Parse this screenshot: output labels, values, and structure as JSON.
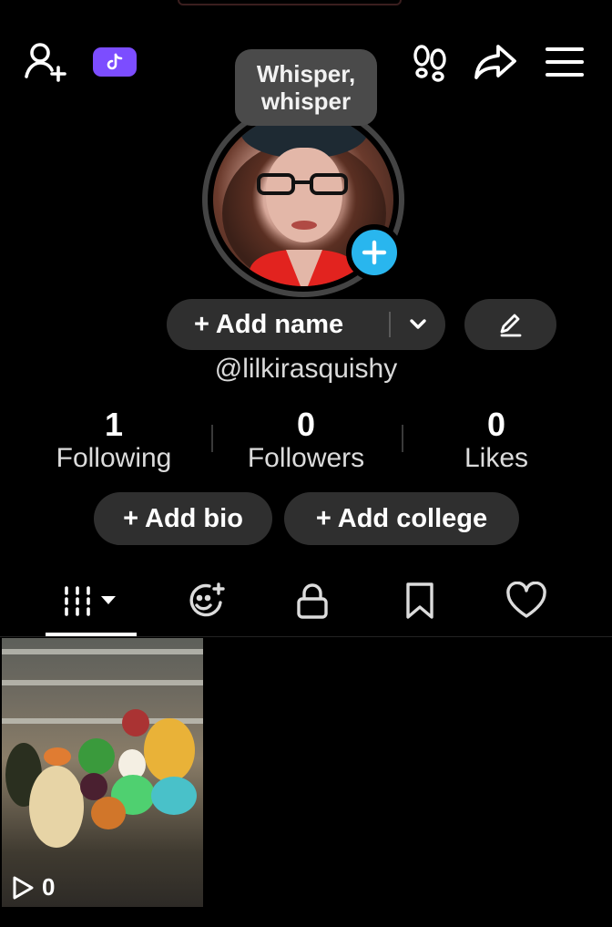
{
  "profile": {
    "tooltip_line1": "Whisper,",
    "tooltip_line2": "whisper",
    "add_name_label": "+ Add name",
    "username": "@lilkirasquishy"
  },
  "stats": [
    {
      "value": "1",
      "label": "Following"
    },
    {
      "value": "0",
      "label": "Followers"
    },
    {
      "value": "0",
      "label": "Likes"
    }
  ],
  "actions": {
    "add_bio": "+ Add bio",
    "add_college": "+ Add college"
  },
  "videos": [
    {
      "views": "0"
    }
  ],
  "icons": {
    "topbar": [
      "add-friend-icon",
      "tiktok-badge-icon",
      "footprint-icon",
      "share-icon",
      "menu-icon"
    ],
    "tabs": [
      "videos-grid-icon",
      "reposts-icon",
      "lock-icon",
      "bookmark-icon",
      "heart-icon"
    ]
  },
  "colors": {
    "background": "#000000",
    "pill": "#2f2f2f",
    "accent_blue": "#29b6ee",
    "badge_purple": "#7c4dff"
  }
}
